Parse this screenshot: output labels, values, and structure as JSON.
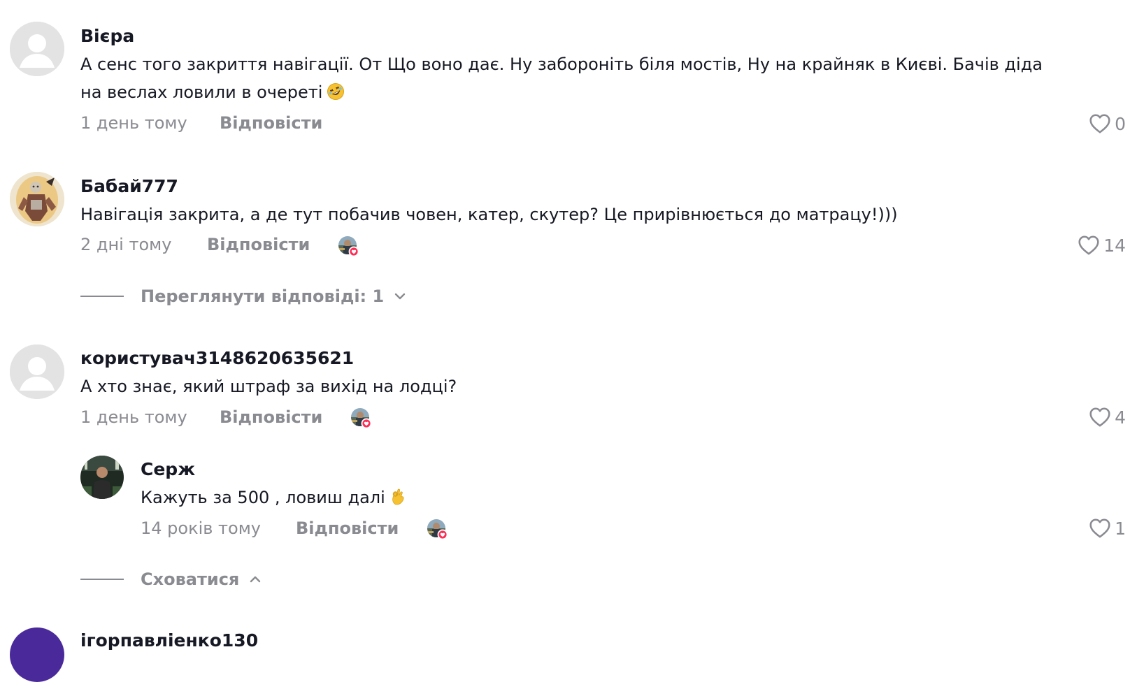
{
  "labels": {
    "reply": "Відповісти",
    "hide": "Сховатися"
  },
  "colors": {
    "text_primary": "#161823",
    "text_secondary": "#8a8b91",
    "like_badge": "#fe2c55",
    "avatar_placeholder": "#e3e3e4",
    "avatar_purple": "#4a2a9a"
  },
  "comments": [
    {
      "username": "Вієра",
      "avatar": "default-avatar-icon",
      "text_line1": "А сенс того закриття навігації. От Що воно дає. Ну забороніть біля мостів, Ну на крайняк в Києві. Бачів діда",
      "text_line2": "на веслах ловили в очереті",
      "emoji": "rolling-laughing-emoji",
      "time": "1 день тому",
      "likes": "0"
    },
    {
      "username": "Бабай777",
      "avatar": "warrior-avatar",
      "text_line1": "Навігація закрита, а де тут побачив човен, катер, скутер? Це прирівнюється до матрацу!)))",
      "time": "2 дні тому",
      "likes": "14",
      "creator_liked": true,
      "view_replies": "Переглянути відповіді: 1"
    },
    {
      "username": "користувач3148620635621",
      "avatar": "default-avatar-icon",
      "text_line1": "А хто знає, який штраф за вихід на лодці?",
      "time": "1 день тому",
      "likes": "4",
      "creator_liked": true,
      "reply": {
        "username": "Серж",
        "avatar": "man-photo-avatar",
        "text_line1": "Кажуть за 500 , ловиш далі",
        "emoji": "ok-hand-emoji",
        "time": "14 років тому",
        "likes": "1",
        "creator_liked": true
      }
    },
    {
      "username": "ігорпавліенко130",
      "avatar": "purple-avatar"
    }
  ]
}
